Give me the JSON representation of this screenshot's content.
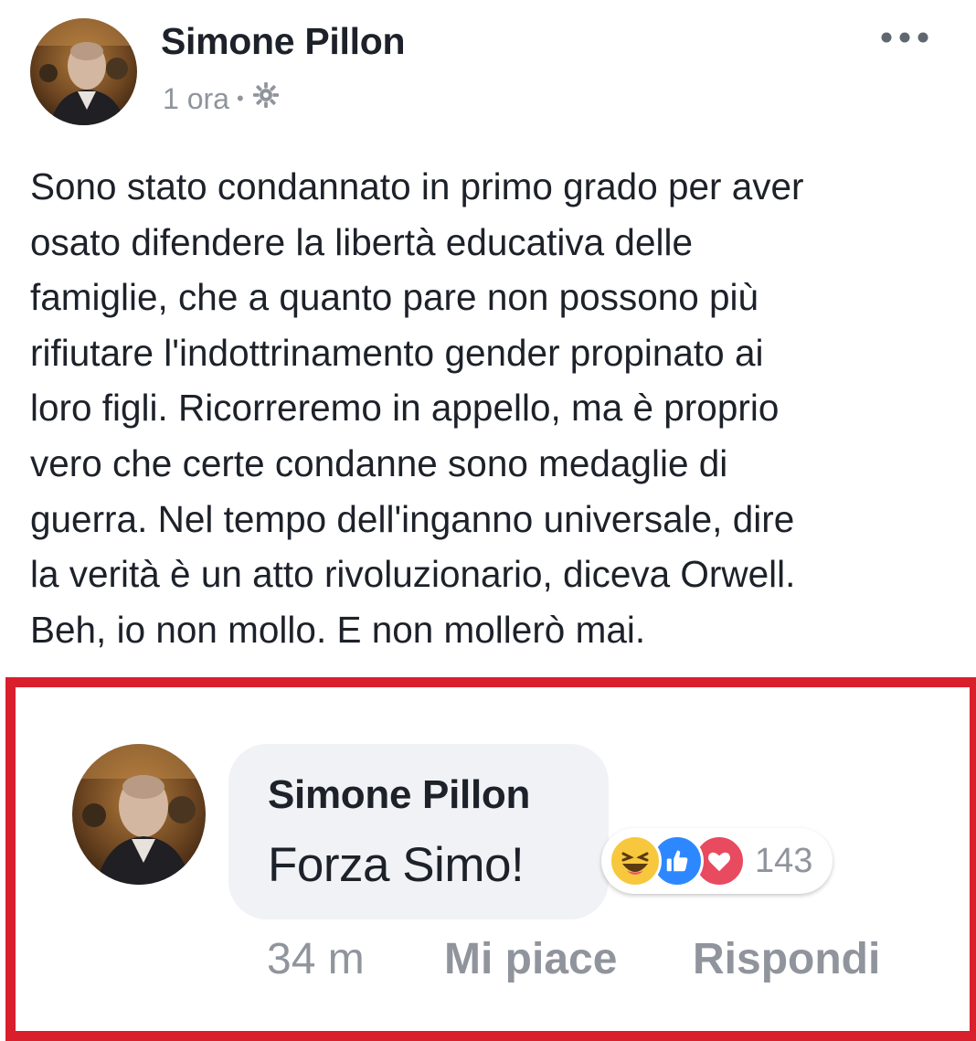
{
  "post": {
    "author": "Simone Pillon",
    "time": "1 ora",
    "separator": "•",
    "privacy_icon": "gear-icon",
    "more_icon": "more-options-icon",
    "body_lines": [
      "Sono stato condannato in primo grado per aver",
      "osato difendere la libertà educativa delle",
      "famiglie, che a quanto pare non possono più",
      "rifiutare l'indottrinamento gender propinato ai",
      "loro figli. Ricorreremo in appello, ma è proprio",
      "vero che certe condanne sono medaglie di",
      "guerra. Nel tempo dell'inganno universale, dire",
      "la verità è un atto rivoluzionario, diceva Orwell.",
      "Beh, io non mollo. E non mollerò mai."
    ]
  },
  "comment": {
    "author": "Simone Pillon",
    "text": "Forza Simo!",
    "reactions": [
      "haha",
      "like",
      "love"
    ],
    "reaction_count": "143",
    "time": "34 m",
    "like_label": "Mi piace",
    "reply_label": "Rispondi"
  },
  "colors": {
    "highlight_border": "#d91e2c",
    "muted_text": "#90949c",
    "bubble_background": "#f0f2f5",
    "like_blue": "#2d88ff",
    "love_red": "#e84a5f",
    "haha_yellow": "#f7c83d"
  }
}
